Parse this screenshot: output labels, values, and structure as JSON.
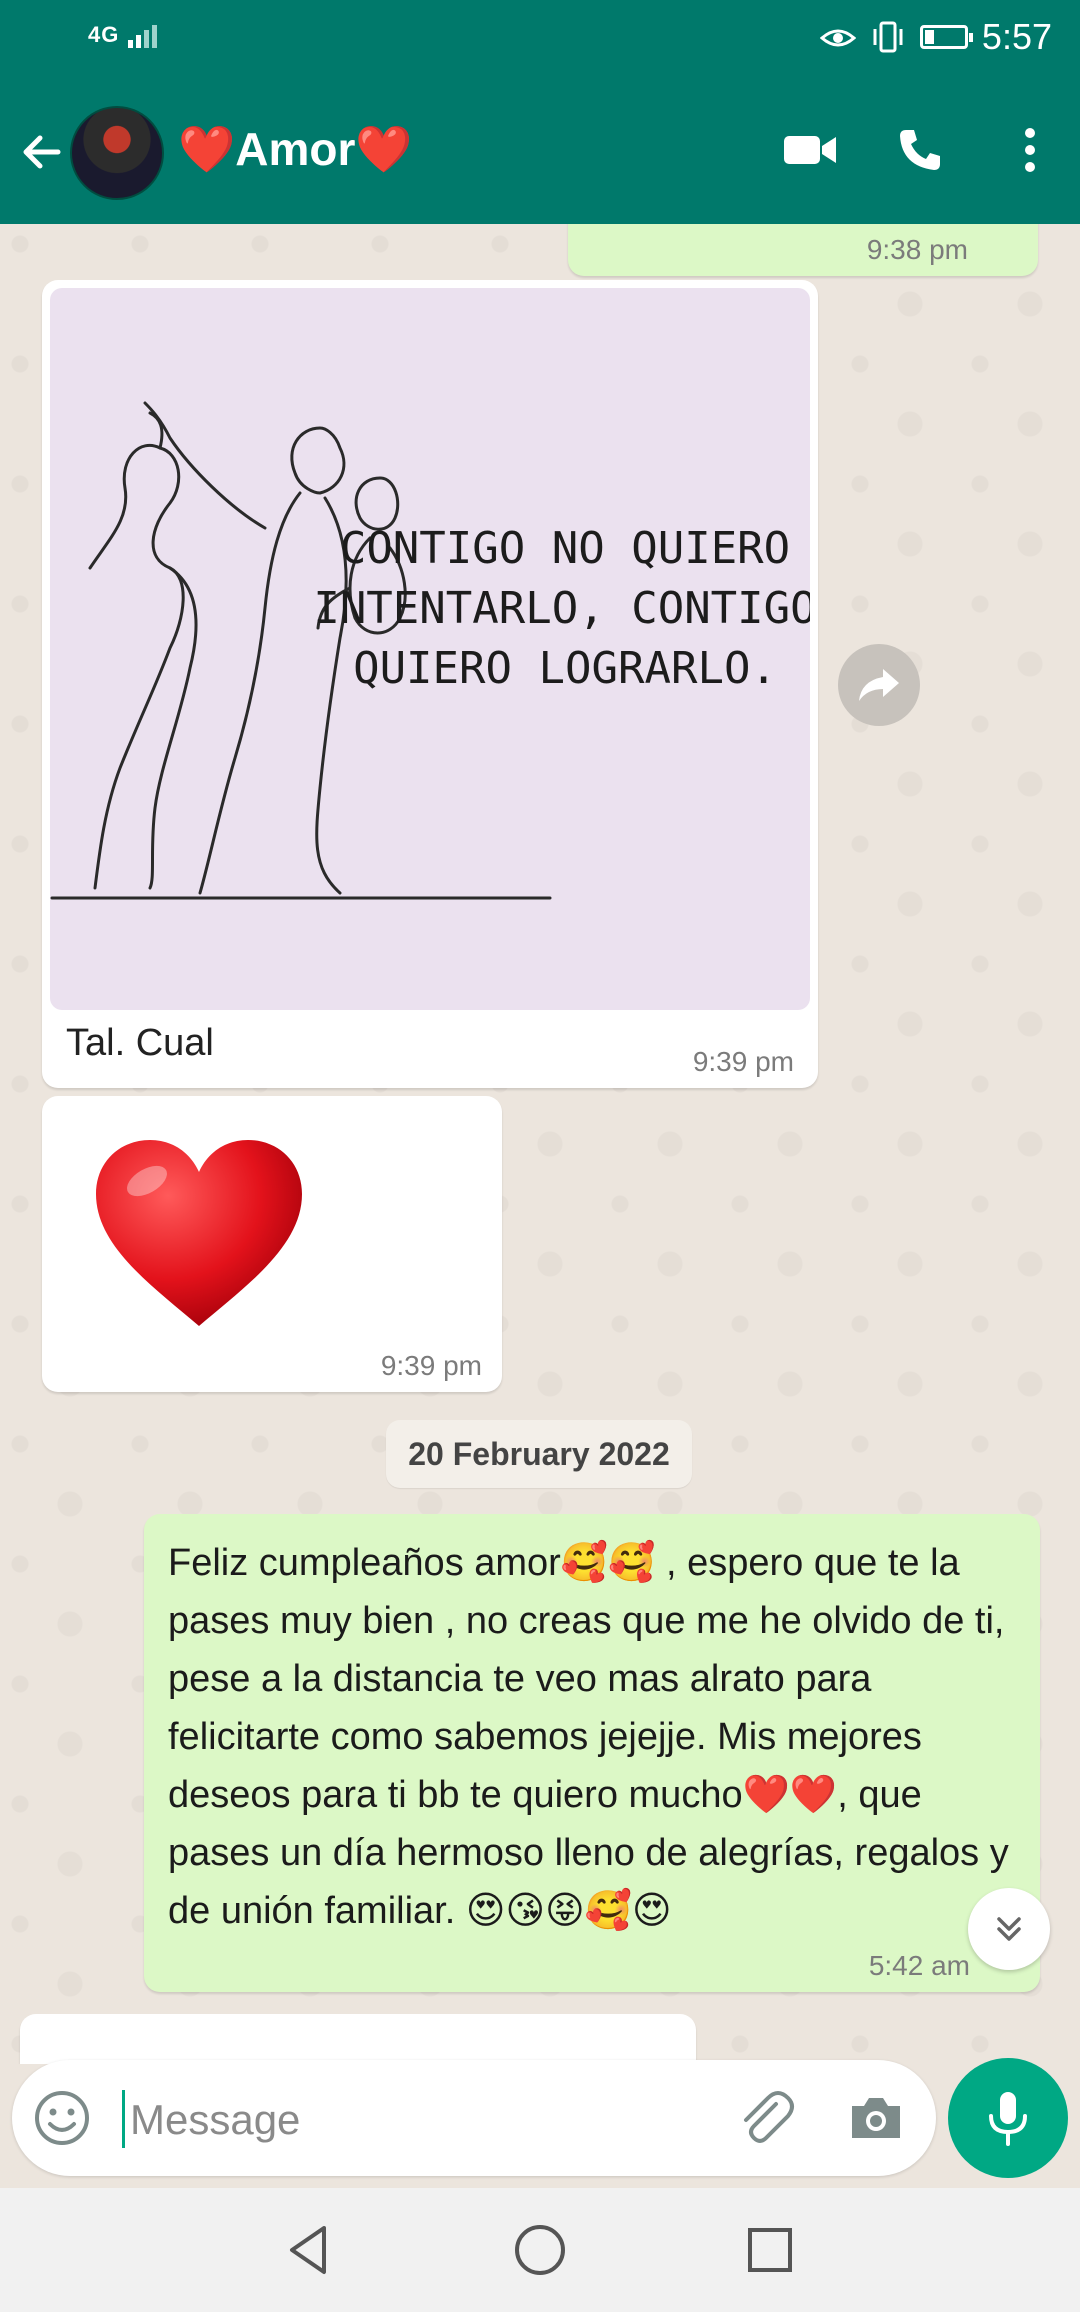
{
  "status_bar": {
    "network": "4G",
    "time": "5:57",
    "battery_level_percent": 30,
    "icons": [
      "eye-comfort-icon",
      "vibrate-icon",
      "battery-icon",
      "signal-icon"
    ]
  },
  "header": {
    "contact_name": "❤️Amor❤️",
    "icons": [
      "back-arrow-icon",
      "video-call-icon",
      "voice-call-icon",
      "more-options-icon"
    ]
  },
  "messages": [
    {
      "id": "partial-top",
      "direction": "out",
      "time": "9:38 pm"
    },
    {
      "id": "image-message",
      "direction": "in",
      "image_text": [
        "CONTIGO NO QUIERO",
        "INTENTARLO, CONTIGO",
        "QUIERO LOGRARLO."
      ],
      "caption": "Tal. Cual",
      "time": "9:39 pm"
    },
    {
      "id": "heart-message",
      "direction": "in",
      "content": "heart-emoji",
      "time": "9:39 pm"
    }
  ],
  "date_separator": "20 February 2022",
  "birthday_message": {
    "direction": "out",
    "text": "Feliz cumpleaños amor🥰🥰 , espero que te la pases muy bien , no creas que me he olvido de ti, pese a la distancia te veo mas alrato para felicitarte como sabemos jejejje. Mis  mejores deseos para ti bb te  quiero mucho❤️❤️, que pases un día hermoso lleno de alegrías, regalos y de unión familiar. 😍😘😝🥰😍",
    "time": "5:42 am"
  },
  "composer": {
    "placeholder": "Message",
    "icons": [
      "emoji-icon",
      "attach-icon",
      "camera-icon",
      "mic-icon"
    ]
  },
  "nav_bar": {
    "icons": [
      "back-triangle-icon",
      "home-circle-icon",
      "recents-square-icon"
    ]
  },
  "colors": {
    "header": "#00796b",
    "chat_background": "#ece5dd",
    "outgoing_bubble": "#dcf8c6",
    "incoming_bubble": "#ffffff",
    "accent": "#00a884",
    "image_background": "#ebe1ef"
  }
}
